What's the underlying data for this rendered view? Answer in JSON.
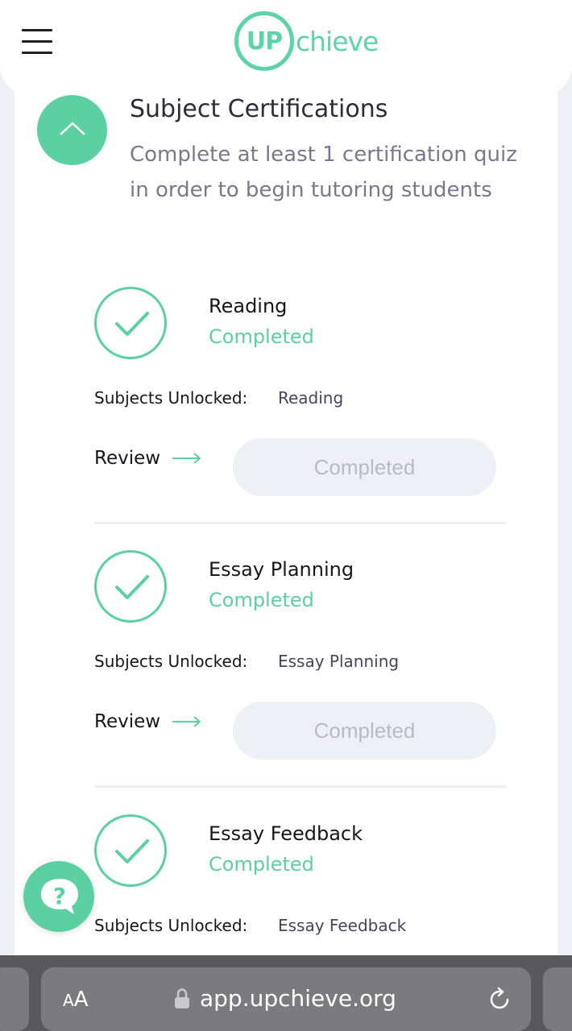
{
  "header": {
    "logo_up": "UP",
    "logo_rest": "chieve",
    "menu_icon": "hamburger-menu-icon"
  },
  "section": {
    "title": "Subject Certifications",
    "description": "Complete at least 1 certification quiz in order to begin tutoring students",
    "toggle_icon": "chevron-up-icon"
  },
  "certifications": [
    {
      "name": "Reading",
      "status": "Completed",
      "unlock_label": "Subjects Unlocked:",
      "unlocked": "Reading",
      "review_label": "Review",
      "button_label": "Completed"
    },
    {
      "name": "Essay Planning",
      "status": "Completed",
      "unlock_label": "Subjects Unlocked:",
      "unlocked": "Essay Planning",
      "review_label": "Review",
      "button_label": "Completed"
    },
    {
      "name": "Essay Feedback",
      "status": "Completed",
      "unlock_label": "Subjects Unlocked:",
      "unlocked": "Essay Feedback"
    }
  ],
  "help": {
    "icon": "help-question-icon"
  },
  "browser": {
    "text_size_label_small": "A",
    "text_size_label_large": "A",
    "url": "app.upchieve.org",
    "lock_icon": "lock-icon",
    "reload_icon": "reload-icon"
  },
  "colors": {
    "accent": "#5ccfa3",
    "background": "#eef0f5",
    "muted_text": "#77798c",
    "disabled_text": "#b8bac6",
    "browser_bar": "#59595c"
  }
}
